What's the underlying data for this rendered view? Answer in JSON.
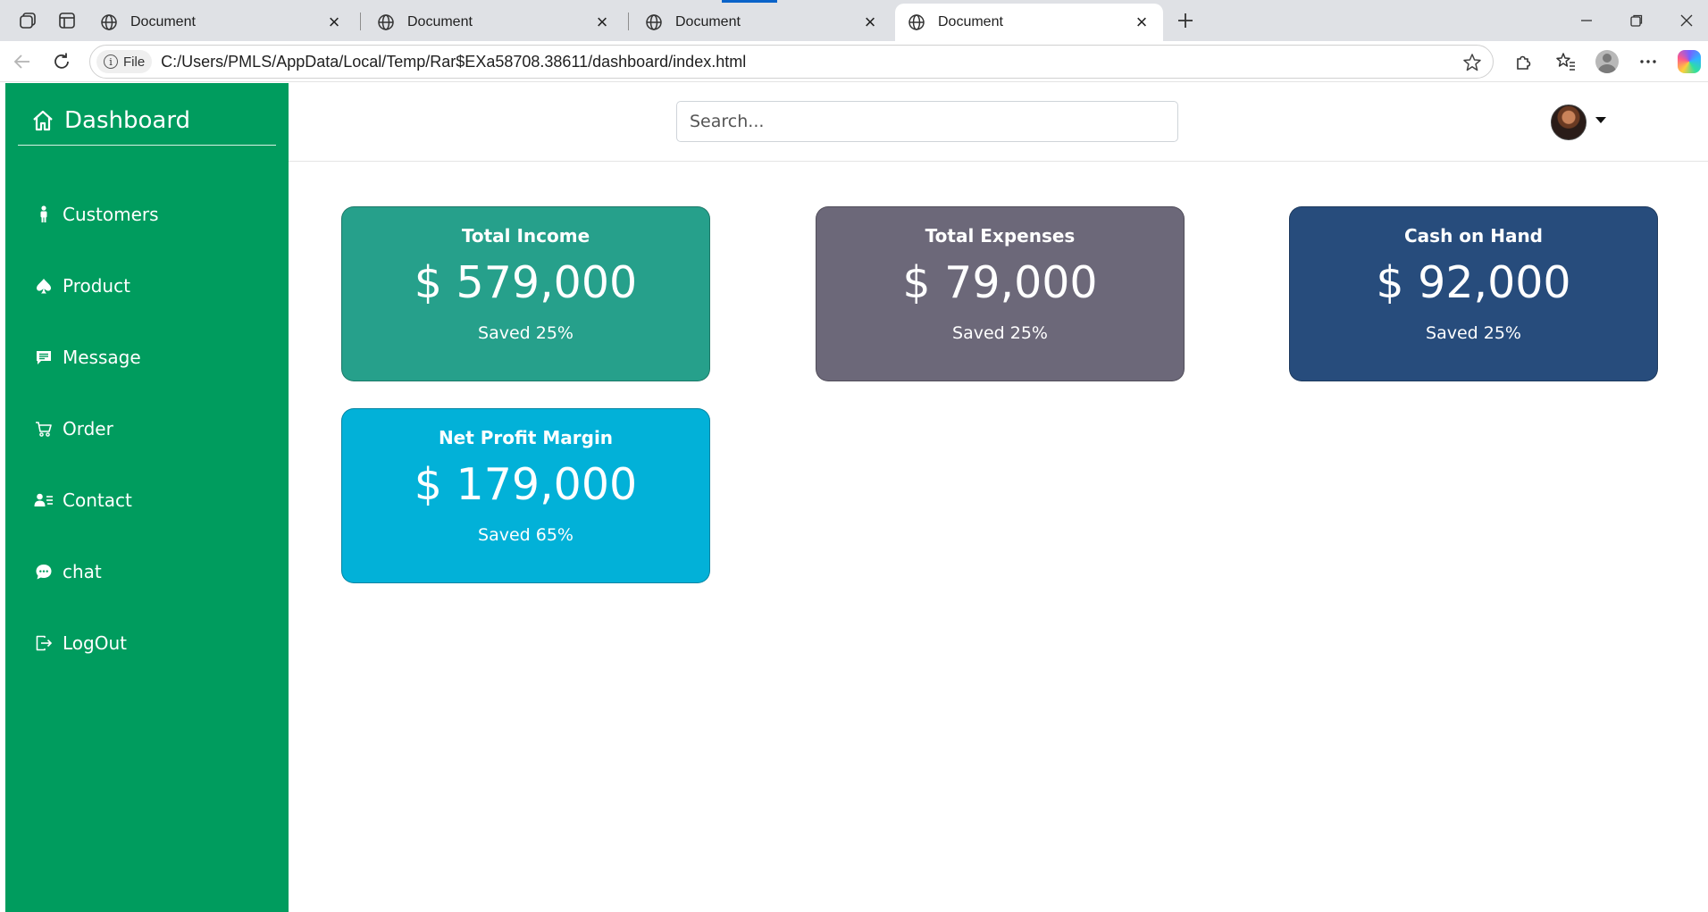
{
  "browser": {
    "tabs": [
      {
        "title": "Document"
      },
      {
        "title": "Document"
      },
      {
        "title": "Document"
      },
      {
        "title": "Document"
      }
    ],
    "url_chip": "File",
    "url": "C:/Users/PMLS/AppData/Local/Temp/Rar$EXa58708.38611/dashboard/index.html"
  },
  "sidebar": {
    "brand": "Dashboard",
    "items": [
      {
        "label": "Customers",
        "icon": "person-icon"
      },
      {
        "label": "Product",
        "icon": "spade-icon"
      },
      {
        "label": "Message",
        "icon": "message-icon"
      },
      {
        "label": "Order",
        "icon": "cart-icon"
      },
      {
        "label": "Contact",
        "icon": "contact-card-icon"
      },
      {
        "label": "chat",
        "icon": "chat-bubble-icon"
      },
      {
        "label": "LogOut",
        "icon": "logout-icon"
      }
    ]
  },
  "topbar": {
    "search_placeholder": "Search..."
  },
  "cards": [
    {
      "title": "Total Income",
      "value": "$ 579,000",
      "sub": "Saved 25%",
      "color": "#26a08b"
    },
    {
      "title": "Total Expenses",
      "value": "$ 79,000",
      "sub": "Saved 25%",
      "color": "#6c6879"
    },
    {
      "title": "Cash on Hand",
      "value": "$ 92,000",
      "sub": "Saved 25%",
      "color": "#274c7c"
    },
    {
      "title": "Net Profit Margin",
      "value": "$ 179,000",
      "sub": "Saved 65%",
      "color": "#02b1d8"
    }
  ],
  "colors": {
    "sidebar": "#009c5e"
  }
}
